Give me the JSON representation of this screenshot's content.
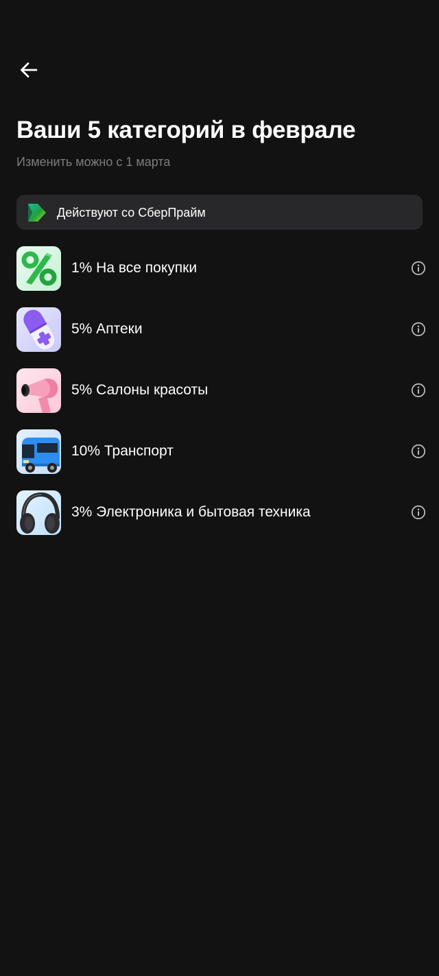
{
  "header": {
    "back_icon": "arrow-left-icon",
    "title": "Ваши 5 категорий в феврале",
    "subtitle": "Изменить можно с 1 марта"
  },
  "prime_banner": {
    "icon": "sberprime-logo-icon",
    "text": "Действуют со СберПрайм",
    "accent_color": "#21a038"
  },
  "categories": [
    {
      "label": "1% На все покупки",
      "icon": "percent-icon",
      "info_icon": "info-icon"
    },
    {
      "label": "5% Аптеки",
      "icon": "pill-capsule-icon",
      "info_icon": "info-icon"
    },
    {
      "label": "5% Салоны красоты",
      "icon": "hair-dryer-icon",
      "info_icon": "info-icon"
    },
    {
      "label": "10% Транспорт",
      "icon": "bus-icon",
      "info_icon": "info-icon"
    },
    {
      "label": "3% Электроника и бытовая техника",
      "icon": "headphones-icon",
      "info_icon": "info-icon"
    }
  ],
  "colors": {
    "background": "#121212",
    "banner_background": "#28282a",
    "subtitle_text": "#7d7d7f",
    "text": "#ffffff"
  }
}
